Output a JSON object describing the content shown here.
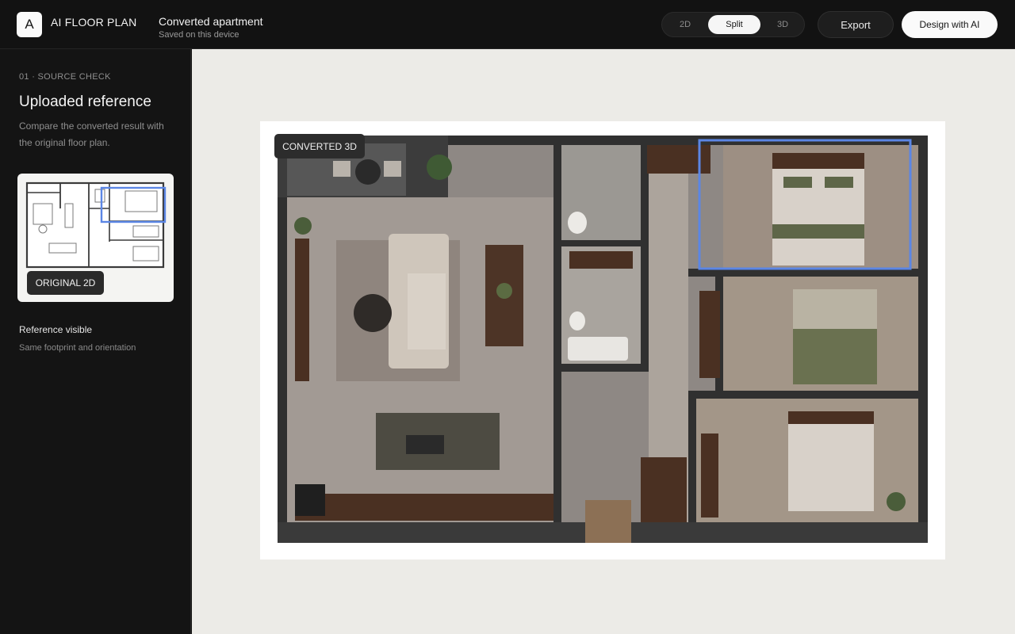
{
  "header": {
    "logo_letter": "A",
    "brand": "AI FLOOR PLAN",
    "project_title": "Converted apartment",
    "project_subtitle": "Saved on this device",
    "view_modes": [
      "2D",
      "Split",
      "3D"
    ],
    "active_view": "Split",
    "export_label": "Export",
    "design_label": "Design with AI"
  },
  "sidebar": {
    "step_label": "01 · SOURCE CHECK",
    "title": "Uploaded reference",
    "description": "Compare the converted result with the original floor plan.",
    "reference_chip": "ORIGINAL 2D",
    "status_title": "Reference visible",
    "status_subtitle": "Same footprint and orientation"
  },
  "canvas": {
    "converted_chip": "CONVERTED 3D",
    "highlight_color": "#5b86e5"
  }
}
